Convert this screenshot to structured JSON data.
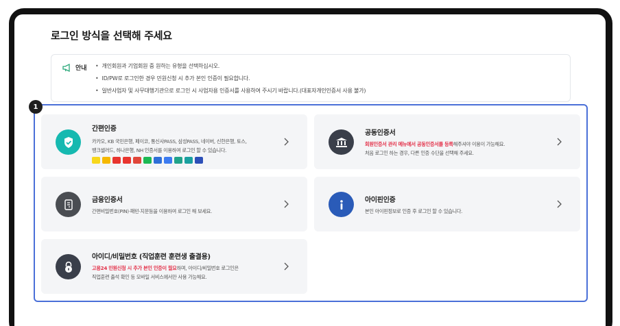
{
  "page": {
    "title": "로그인 방식을 선택해 주세요",
    "badge_number": "1"
  },
  "notice": {
    "label": "안내",
    "lines": [
      "개인회원과 기업회원 중 원하는 유형을 선택하십시오.",
      "ID/PW로 로그인한 경우 민원신청 시 추가 본인 인증이 필요합니다.",
      "일반사업자 및 사무대행기관으로 로그인 시 사업자용 인증서를 사용하여 주시기 바랍니다.(대표자개인인증서 사용 불가)"
    ]
  },
  "cards": {
    "simple": {
      "title": "간편인증",
      "desc_line1": "카카오, KB 국민은행, 페이코, 통신사PASS, 삼성PASS, 네이버, 신한은행, 토스,",
      "desc_line2": "뱅크샐러드, 하나은행, NH 인증서를 이용하여 로그인 할 수 있습니다.",
      "providers": [
        "#f7d71c",
        "#f5b800",
        "#e8352f",
        "#e8352f",
        "#e0463a",
        "#1db954",
        "#2f6fd8",
        "#3c7bf0",
        "#21a38b",
        "#1aa0a0",
        "#2c4fb8"
      ]
    },
    "public": {
      "title": "공동인증서",
      "desc_red": "회원인증서 관리 메뉴에서 공동인증서를 등록",
      "desc_rest": "해주셔야 이용이 가능해요.",
      "desc_line2": "처음 로그인 하는 경우, 다른 인증 수단을 선택해 주세요."
    },
    "finance": {
      "title": "금융인증서",
      "desc_line1": "간편비밀번호(PIN)·패턴·지문등을 이용하여 로그인 해 보세요."
    },
    "ipin": {
      "title": "아이핀인증",
      "desc_line1": "본인 아이핀정보로 인증 후 로그인 할 수 있습니다."
    },
    "idpw": {
      "title": "아이디/비밀번호 (직업훈련 훈련생 출결용)",
      "desc_red": "고용24 민원신청 시 추가 본인 인증이 필요",
      "desc_rest": "하며, 아이디/비밀번호 로그인은",
      "desc_line2": "직업훈련 출석 확인 등 모바일 서비스에서만 사용 가능해요."
    }
  },
  "colors": {
    "simple_icon": "#16b9b0",
    "public_icon": "#3a3f4a",
    "finance_icon": "#4a4d52",
    "ipin_icon": "#2a5bb8",
    "idpw_icon": "#3a3f4a",
    "highlight": "#4a6fd8",
    "emphasis": "#e3324a"
  }
}
